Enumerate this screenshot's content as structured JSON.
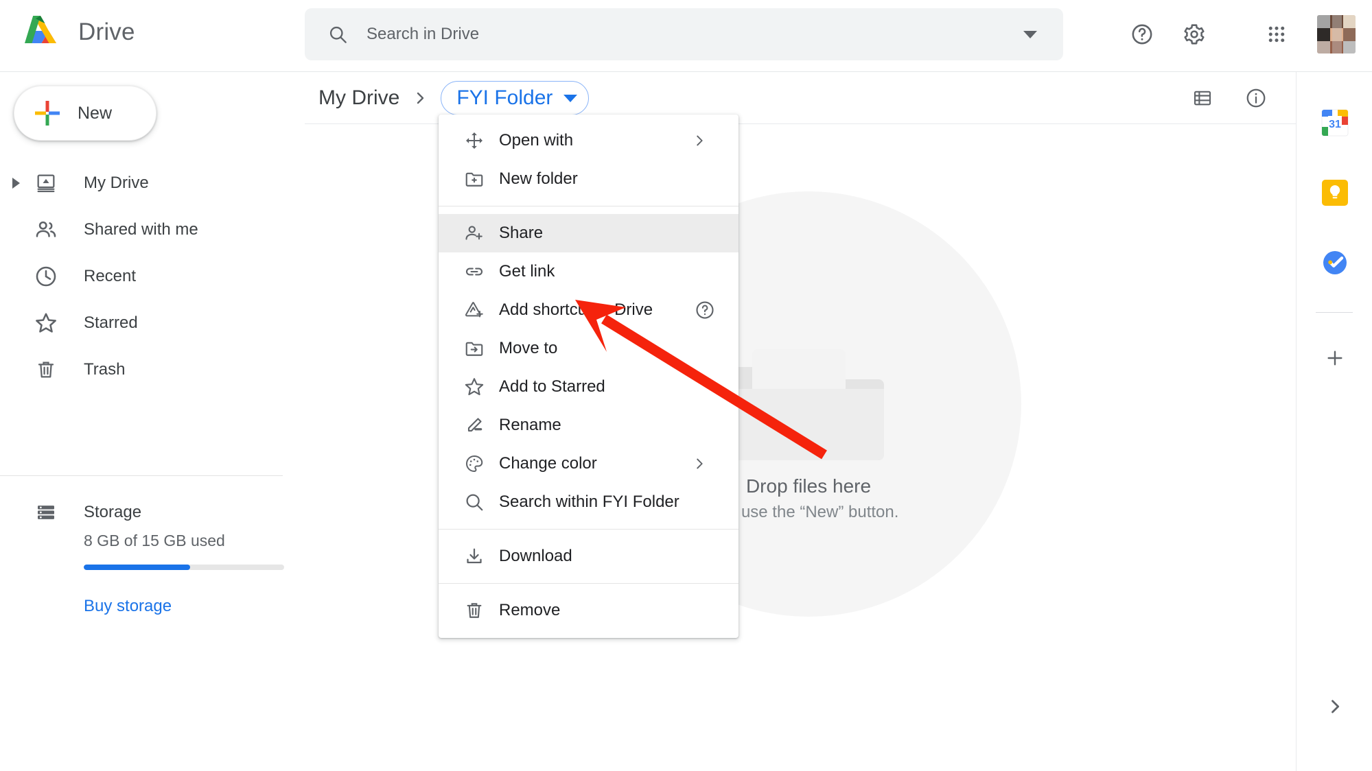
{
  "app": {
    "name": "Drive",
    "logo_icon": "google-drive-logo-icon",
    "accent_blue": "#1a73e8",
    "accent_blue_light": "#8ab4f8"
  },
  "search": {
    "placeholder": "Search in Drive",
    "value": "",
    "icon": "search-icon",
    "options_icon": "chevron-down-icon"
  },
  "header_actions": [
    {
      "name": "support-icon",
      "label": "Support"
    },
    {
      "name": "settings-gear-icon",
      "label": "Settings"
    },
    {
      "name": "google-apps-grid-icon",
      "label": "Google apps"
    },
    {
      "name": "account-avatar",
      "label": "Google Account"
    }
  ],
  "sidebar": {
    "new_button": {
      "label": "New",
      "icon": "plus-icon"
    },
    "items": [
      {
        "label": "My Drive",
        "icon": "my-drive-icon",
        "expandable": true
      },
      {
        "label": "Shared with me",
        "icon": "people-icon",
        "expandable": false
      },
      {
        "label": "Recent",
        "icon": "clock-icon",
        "expandable": false
      },
      {
        "label": "Starred",
        "icon": "star-outline-icon",
        "expandable": false
      },
      {
        "label": "Trash",
        "icon": "trash-icon",
        "expandable": false
      }
    ],
    "storage": {
      "label": "Storage",
      "icon": "storage-icon",
      "used_text": "8 GB of 15 GB used",
      "used_percent": 53,
      "buy_label": "Buy storage"
    }
  },
  "breadcrumb": {
    "root": "My Drive",
    "separator_icon": "chevron-right-icon",
    "current": "FYI Folder",
    "current_dropdown_icon": "caret-down-icon"
  },
  "content_toolbar": [
    {
      "name": "list-view-icon",
      "label": "List view"
    },
    {
      "name": "details-info-icon",
      "label": "View details"
    }
  ],
  "empty_state": {
    "line1": "Drop files here",
    "line2": "Or use the “New” button.",
    "graphic": "empty-folder-illustration"
  },
  "context_menu": {
    "groups": [
      {
        "items": [
          {
            "label": "Open with",
            "icon": "open-with-icon",
            "submenu": true,
            "highlighted": false
          },
          {
            "label": "New folder",
            "icon": "new-folder-icon",
            "submenu": false,
            "highlighted": false
          }
        ]
      },
      {
        "items": [
          {
            "label": "Share",
            "icon": "share-person-add-icon",
            "submenu": false,
            "highlighted": true
          },
          {
            "label": "Get link",
            "icon": "link-icon",
            "submenu": false,
            "highlighted": false
          },
          {
            "label": "Add shortcut to Drive",
            "icon": "add-shortcut-icon",
            "submenu": false,
            "highlighted": false,
            "help": true
          },
          {
            "label": "Move to",
            "icon": "move-to-folder-icon",
            "submenu": false,
            "highlighted": false
          },
          {
            "label": "Add to Starred",
            "icon": "star-outline-icon",
            "submenu": false,
            "highlighted": false
          },
          {
            "label": "Rename",
            "icon": "pencil-icon",
            "submenu": false,
            "highlighted": false
          },
          {
            "label": "Change color",
            "icon": "palette-icon",
            "submenu": true,
            "highlighted": false
          },
          {
            "label": "Search within FYI Folder",
            "icon": "search-icon",
            "submenu": false,
            "highlighted": false
          }
        ]
      },
      {
        "items": [
          {
            "label": "Download",
            "icon": "download-icon",
            "submenu": false,
            "highlighted": false
          }
        ]
      },
      {
        "items": [
          {
            "label": "Remove",
            "icon": "trash-icon",
            "submenu": false,
            "highlighted": false
          }
        ]
      }
    ]
  },
  "side_rail": {
    "apps": [
      {
        "name": "google-calendar-icon",
        "label": "Calendar",
        "badge": "31"
      },
      {
        "name": "google-keep-icon",
        "label": "Keep"
      },
      {
        "name": "google-tasks-icon",
        "label": "Tasks"
      }
    ],
    "add_label": "Get Add-ons",
    "add_icon": "plus-icon",
    "expand_icon": "chevron-right-icon"
  },
  "annotation": {
    "type": "arrow",
    "color": "#f5230c",
    "points_to": "Get link"
  }
}
